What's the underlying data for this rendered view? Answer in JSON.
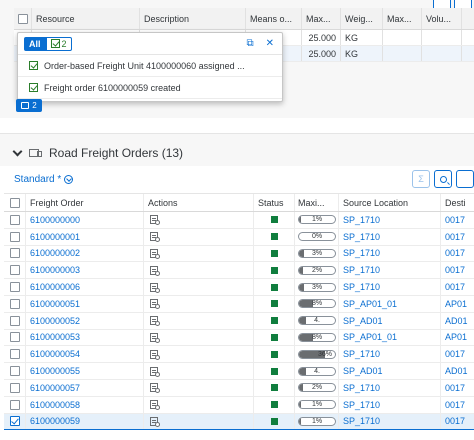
{
  "resource_table": {
    "headers": [
      "Resource",
      "Description",
      "Means o...",
      "Max...",
      "Weig...",
      "Max...",
      "Volu..."
    ],
    "rows": [
      {
        "max_weight": "25.000",
        "weight_uom": "KG"
      },
      {
        "max_weight": "25.000",
        "weight_uom": "KG"
      }
    ]
  },
  "message_popover": {
    "filter_all": "All",
    "filter_success_count": "2",
    "messages": [
      "Order-based Freight Unit 4100000060 assigned ...",
      "Freight order 6100000059 created"
    ]
  },
  "message_badge": {
    "count": "2"
  },
  "freight_orders": {
    "title": "Road Freight Orders (13)",
    "variant": "Standard *",
    "headers": {
      "freight_order": "Freight Order",
      "actions": "Actions",
      "status": "Status",
      "maxi": "Maxi...",
      "source_location": "Source Location",
      "destination": "Desti"
    },
    "rows": [
      {
        "id": "6100000000",
        "util": 1,
        "util_label": "1%",
        "source": "SP_1710",
        "dest": "0017",
        "selected": false
      },
      {
        "id": "6100000001",
        "util": 0,
        "util_label": "0%",
        "source": "SP_1710",
        "dest": "0017",
        "selected": false
      },
      {
        "id": "6100000002",
        "util": 3,
        "util_label": "3%",
        "source": "SP_1710",
        "dest": "0017",
        "selected": false
      },
      {
        "id": "6100000003",
        "util": 2,
        "util_label": "2%",
        "source": "SP_1710",
        "dest": "0017",
        "selected": false
      },
      {
        "id": "6100000006",
        "util": 3,
        "util_label": "3%",
        "source": "SP_1710",
        "dest": "0017",
        "selected": false
      },
      {
        "id": "6100000051",
        "util": 8,
        "util_label": "8%",
        "source": "SP_AP01_01",
        "dest": "AP01",
        "selected": false
      },
      {
        "id": "6100000052",
        "util": 4,
        "util_label": "4.",
        "source": "SP_AD01",
        "dest": "AD01",
        "selected": false
      },
      {
        "id": "6100000053",
        "util": 8,
        "util_label": "8%",
        "source": "SP_AP01_01",
        "dest": "AP01",
        "selected": false
      },
      {
        "id": "6100000054",
        "util": 36,
        "util_label": "36%",
        "source": "SP_1710",
        "dest": "0017",
        "selected": false
      },
      {
        "id": "6100000055",
        "util": 4,
        "util_label": "4.",
        "source": "SP_AD01",
        "dest": "AD01",
        "selected": false
      },
      {
        "id": "6100000057",
        "util": 2,
        "util_label": "2%",
        "source": "SP_1710",
        "dest": "0017",
        "selected": false
      },
      {
        "id": "6100000058",
        "util": 1,
        "util_label": "1%",
        "source": "SP_1710",
        "dest": "0017",
        "selected": false
      },
      {
        "id": "6100000059",
        "util": 1,
        "util_label": "1%",
        "source": "SP_1710",
        "dest": "0017",
        "selected": true
      }
    ]
  },
  "colors": {
    "accent": "#0a6ed1",
    "status_green": "#107e3e",
    "selected_row": "#e5f0fa"
  }
}
